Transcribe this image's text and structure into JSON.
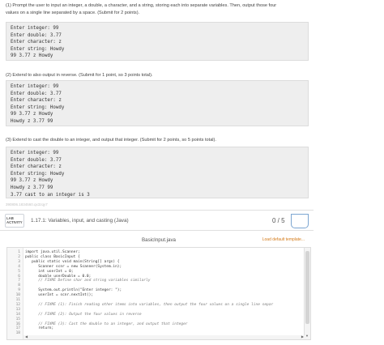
{
  "instructions": {
    "step1_line1": "(1) Prompt the user to input an integer, a double, a character, and a string, storing each into separate variables. Then, output those four",
    "step1_line2": "values on a single line separated by a space. (Submit for 2 points).",
    "step2": "(2) Extend to also output in reverse. (Submit for 1 point, so 3 points total).",
    "step3": "(3) Extend to cast the double to an integer, and output that integer. (Submit for 2 points, so 5 points total)."
  },
  "output1": [
    "Enter integer: 99",
    "Enter double: 3.77",
    "Enter character: z",
    "Enter string: Howdy",
    "99 3.77 z Howdy"
  ],
  "output2": [
    "Enter integer: 99",
    "Enter double: 3.77",
    "Enter character: z",
    "Enter string: Howdy",
    "99 3.77 z Howdy",
    "Howdy z 3.77 99"
  ],
  "output3": [
    "Enter integer: 99",
    "Enter double: 3.77",
    "Enter character: z",
    "Enter string: Howdy",
    "99 3.77 z Howdy",
    "Howdy z 3.77 99",
    "3.77 cast to an integer is 3"
  ],
  "feedback_text": "390806.1834560.qx3zqy7",
  "lab": {
    "badge_line1": "LAB",
    "badge_line2": "ACTIVITY",
    "title": "1.17.1: Variables, input, and casting (Java)",
    "score": "0 / 5"
  },
  "editor": {
    "file_name": "BasicInput.java",
    "load_default": "Load default template...",
    "lines": [
      {
        "n": "1",
        "code": "import java.util.Scanner;",
        "comment": ""
      },
      {
        "n": "2",
        "code": "public class BasicInput {",
        "comment": ""
      },
      {
        "n": "3",
        "code": "   public static void main(String[] args) {",
        "comment": ""
      },
      {
        "n": "4",
        "code": "      Scanner scnr = new Scanner(System.in);",
        "comment": ""
      },
      {
        "n": "5",
        "code": "      int userInt = 0;",
        "comment": ""
      },
      {
        "n": "6",
        "code": "      double userDouble = 0.0;",
        "comment": ""
      },
      {
        "n": "7",
        "code": "      ",
        "comment": "// FIXME Define char and string variables similarly"
      },
      {
        "n": "8",
        "code": "",
        "comment": ""
      },
      {
        "n": "9",
        "code": "      System.out.println(\"Enter integer: \");",
        "comment": ""
      },
      {
        "n": "10",
        "code": "      userInt = scnr.nextInt();",
        "comment": ""
      },
      {
        "n": "11",
        "code": "",
        "comment": ""
      },
      {
        "n": "12",
        "code": "      ",
        "comment": "// FIXME (1): Finish reading other items into variables, then output the four values on a single line separ"
      },
      {
        "n": "13",
        "code": "",
        "comment": ""
      },
      {
        "n": "14",
        "code": "      ",
        "comment": "// FIXME (2): Output the four values in reverse"
      },
      {
        "n": "15",
        "code": "",
        "comment": ""
      },
      {
        "n": "16",
        "code": "      ",
        "comment": "// FIXME (3): Cast the double to an integer, and output that integer"
      },
      {
        "n": "17",
        "code": "      return;",
        "comment": ""
      },
      {
        "n": "18",
        "code": "",
        "comment": ""
      }
    ]
  },
  "icons": {
    "scroll_down": "▼",
    "scroll_left": "◀",
    "scroll_right": "▶"
  },
  "colors": {
    "accent_orange": "#d47a18",
    "lab_icon_blue": "#7ca6d1"
  }
}
